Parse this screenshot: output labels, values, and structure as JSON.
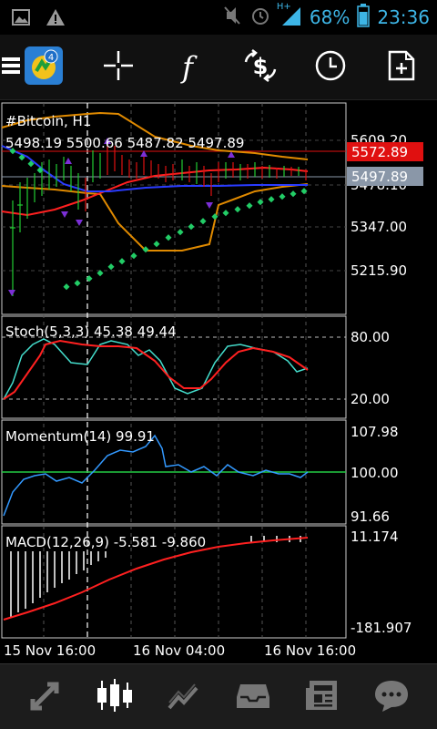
{
  "status": {
    "battery_percent": "68%",
    "time": "23:36",
    "network": "H+",
    "colors": {
      "accent": "#3db5e6"
    }
  },
  "toolbar": {
    "items": [
      {
        "icon": "menu-icon"
      },
      {
        "icon": "metatrader-logo-icon",
        "badge": "4"
      },
      {
        "icon": "crosshair-icon"
      },
      {
        "icon": "function-icon",
        "glyph": "f"
      },
      {
        "icon": "symbol-change-icon",
        "glyph": "$"
      },
      {
        "icon": "clock-icon"
      },
      {
        "icon": "add-document-icon"
      }
    ]
  },
  "main_chart": {
    "symbol_timeframe": "#Bitcoin, H1",
    "ohlc": "5498.19 5500.66 5487.82 5497.89",
    "price_labels": [
      "5609.20",
      "5478.10",
      "5347.00",
      "5215.90"
    ],
    "ask_price": "5572.89",
    "bid_price": "5497.89",
    "colors": {
      "ask": "#e01010",
      "bid": "#8a97a8",
      "bollinger": "#e08a00",
      "ma_fast": "#ff2020",
      "ma_slow": "#2a3cff",
      "sar": "#22cc66",
      "fractal": "#7b2fd6"
    }
  },
  "stoch": {
    "label": "Stoch(5,3,3) 45.38 49.44",
    "levels": [
      "80.00",
      "20.00"
    ],
    "colors": {
      "main": "#44ddcc",
      "signal": "#ff2020"
    }
  },
  "momentum": {
    "label": "Momentum(14) 99.91",
    "levels": [
      "107.98",
      "100.00",
      "91.66"
    ],
    "colors": {
      "line": "#3399ff",
      "level": "#22cc44"
    }
  },
  "macd": {
    "label": "MACD(12,26,9) -5.581 -9.860",
    "levels": [
      "11.174",
      "-181.907"
    ],
    "colors": {
      "histogram": "#ffffff",
      "signal": "#ff2020"
    }
  },
  "time_axis": [
    "15 Nov 16:00",
    "16 Nov 04:00",
    "16 Nov 16:00"
  ],
  "bottom_nav": [
    {
      "icon": "quotes-icon"
    },
    {
      "icon": "chart-icon",
      "active": true
    },
    {
      "icon": "trade-icon"
    },
    {
      "icon": "history-icon"
    },
    {
      "icon": "news-icon"
    },
    {
      "icon": "chat-icon"
    }
  ]
}
